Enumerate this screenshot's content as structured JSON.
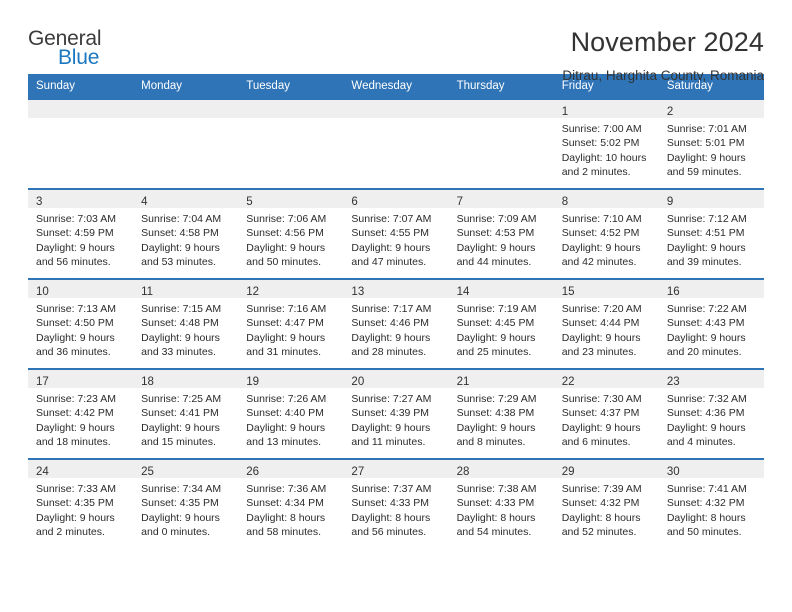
{
  "brand": {
    "name_part1": "General",
    "name_part2": "Blue",
    "triangle_color": "#1c78c0",
    "accent_color": "#2f74b7"
  },
  "header": {
    "title": "November 2024",
    "subtitle": "Ditrau, Harghita County, Romania"
  },
  "calendar": {
    "weekday_headers": [
      "Sunday",
      "Monday",
      "Tuesday",
      "Wednesday",
      "Thursday",
      "Friday",
      "Saturday"
    ],
    "header_bg": "#2f74b7",
    "day_band_bg": "#efefef",
    "weeks": [
      [
        {
          "day": "",
          "lines": []
        },
        {
          "day": "",
          "lines": []
        },
        {
          "day": "",
          "lines": []
        },
        {
          "day": "",
          "lines": []
        },
        {
          "day": "",
          "lines": []
        },
        {
          "day": "1",
          "lines": [
            "Sunrise: 7:00 AM",
            "Sunset: 5:02 PM",
            "Daylight: 10 hours",
            "and 2 minutes."
          ]
        },
        {
          "day": "2",
          "lines": [
            "Sunrise: 7:01 AM",
            "Sunset: 5:01 PM",
            "Daylight: 9 hours",
            "and 59 minutes."
          ]
        }
      ],
      [
        {
          "day": "3",
          "lines": [
            "Sunrise: 7:03 AM",
            "Sunset: 4:59 PM",
            "Daylight: 9 hours",
            "and 56 minutes."
          ]
        },
        {
          "day": "4",
          "lines": [
            "Sunrise: 7:04 AM",
            "Sunset: 4:58 PM",
            "Daylight: 9 hours",
            "and 53 minutes."
          ]
        },
        {
          "day": "5",
          "lines": [
            "Sunrise: 7:06 AM",
            "Sunset: 4:56 PM",
            "Daylight: 9 hours",
            "and 50 minutes."
          ]
        },
        {
          "day": "6",
          "lines": [
            "Sunrise: 7:07 AM",
            "Sunset: 4:55 PM",
            "Daylight: 9 hours",
            "and 47 minutes."
          ]
        },
        {
          "day": "7",
          "lines": [
            "Sunrise: 7:09 AM",
            "Sunset: 4:53 PM",
            "Daylight: 9 hours",
            "and 44 minutes."
          ]
        },
        {
          "day": "8",
          "lines": [
            "Sunrise: 7:10 AM",
            "Sunset: 4:52 PM",
            "Daylight: 9 hours",
            "and 42 minutes."
          ]
        },
        {
          "day": "9",
          "lines": [
            "Sunrise: 7:12 AM",
            "Sunset: 4:51 PM",
            "Daylight: 9 hours",
            "and 39 minutes."
          ]
        }
      ],
      [
        {
          "day": "10",
          "lines": [
            "Sunrise: 7:13 AM",
            "Sunset: 4:50 PM",
            "Daylight: 9 hours",
            "and 36 minutes."
          ]
        },
        {
          "day": "11",
          "lines": [
            "Sunrise: 7:15 AM",
            "Sunset: 4:48 PM",
            "Daylight: 9 hours",
            "and 33 minutes."
          ]
        },
        {
          "day": "12",
          "lines": [
            "Sunrise: 7:16 AM",
            "Sunset: 4:47 PM",
            "Daylight: 9 hours",
            "and 31 minutes."
          ]
        },
        {
          "day": "13",
          "lines": [
            "Sunrise: 7:17 AM",
            "Sunset: 4:46 PM",
            "Daylight: 9 hours",
            "and 28 minutes."
          ]
        },
        {
          "day": "14",
          "lines": [
            "Sunrise: 7:19 AM",
            "Sunset: 4:45 PM",
            "Daylight: 9 hours",
            "and 25 minutes."
          ]
        },
        {
          "day": "15",
          "lines": [
            "Sunrise: 7:20 AM",
            "Sunset: 4:44 PM",
            "Daylight: 9 hours",
            "and 23 minutes."
          ]
        },
        {
          "day": "16",
          "lines": [
            "Sunrise: 7:22 AM",
            "Sunset: 4:43 PM",
            "Daylight: 9 hours",
            "and 20 minutes."
          ]
        }
      ],
      [
        {
          "day": "17",
          "lines": [
            "Sunrise: 7:23 AM",
            "Sunset: 4:42 PM",
            "Daylight: 9 hours",
            "and 18 minutes."
          ]
        },
        {
          "day": "18",
          "lines": [
            "Sunrise: 7:25 AM",
            "Sunset: 4:41 PM",
            "Daylight: 9 hours",
            "and 15 minutes."
          ]
        },
        {
          "day": "19",
          "lines": [
            "Sunrise: 7:26 AM",
            "Sunset: 4:40 PM",
            "Daylight: 9 hours",
            "and 13 minutes."
          ]
        },
        {
          "day": "20",
          "lines": [
            "Sunrise: 7:27 AM",
            "Sunset: 4:39 PM",
            "Daylight: 9 hours",
            "and 11 minutes."
          ]
        },
        {
          "day": "21",
          "lines": [
            "Sunrise: 7:29 AM",
            "Sunset: 4:38 PM",
            "Daylight: 9 hours",
            "and 8 minutes."
          ]
        },
        {
          "day": "22",
          "lines": [
            "Sunrise: 7:30 AM",
            "Sunset: 4:37 PM",
            "Daylight: 9 hours",
            "and 6 minutes."
          ]
        },
        {
          "day": "23",
          "lines": [
            "Sunrise: 7:32 AM",
            "Sunset: 4:36 PM",
            "Daylight: 9 hours",
            "and 4 minutes."
          ]
        }
      ],
      [
        {
          "day": "24",
          "lines": [
            "Sunrise: 7:33 AM",
            "Sunset: 4:35 PM",
            "Daylight: 9 hours",
            "and 2 minutes."
          ]
        },
        {
          "day": "25",
          "lines": [
            "Sunrise: 7:34 AM",
            "Sunset: 4:35 PM",
            "Daylight: 9 hours",
            "and 0 minutes."
          ]
        },
        {
          "day": "26",
          "lines": [
            "Sunrise: 7:36 AM",
            "Sunset: 4:34 PM",
            "Daylight: 8 hours",
            "and 58 minutes."
          ]
        },
        {
          "day": "27",
          "lines": [
            "Sunrise: 7:37 AM",
            "Sunset: 4:33 PM",
            "Daylight: 8 hours",
            "and 56 minutes."
          ]
        },
        {
          "day": "28",
          "lines": [
            "Sunrise: 7:38 AM",
            "Sunset: 4:33 PM",
            "Daylight: 8 hours",
            "and 54 minutes."
          ]
        },
        {
          "day": "29",
          "lines": [
            "Sunrise: 7:39 AM",
            "Sunset: 4:32 PM",
            "Daylight: 8 hours",
            "and 52 minutes."
          ]
        },
        {
          "day": "30",
          "lines": [
            "Sunrise: 7:41 AM",
            "Sunset: 4:32 PM",
            "Daylight: 8 hours",
            "and 50 minutes."
          ]
        }
      ]
    ]
  }
}
